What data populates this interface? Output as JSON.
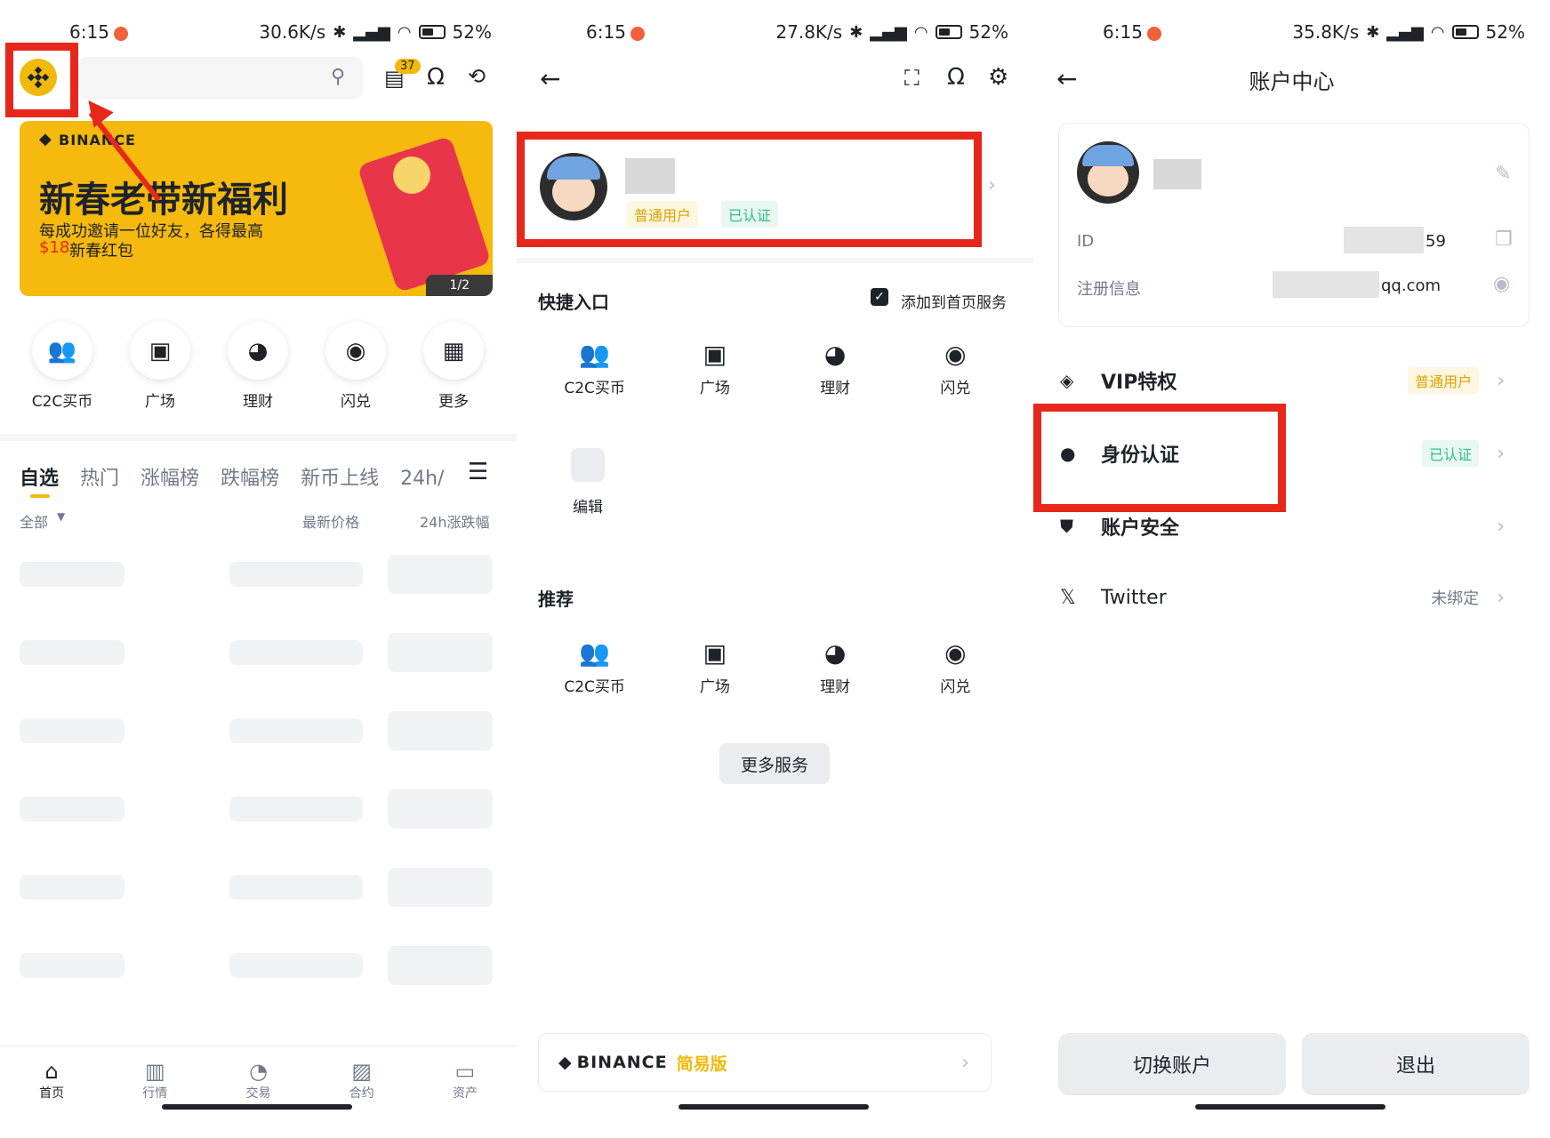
{
  "status": [
    {
      "time": "6:15",
      "speed": "30.6K/s",
      "battery": "52%"
    },
    {
      "time": "6:15",
      "speed": "27.8K/s",
      "battery": "52%"
    },
    {
      "time": "6:15",
      "speed": "35.8K/s",
      "battery": "52%"
    }
  ],
  "p1": {
    "notif_count": "37",
    "banner": {
      "brand": "BINANCE",
      "headline": "新春老带新福利",
      "line1": "每成功邀请一位好友，各得最高",
      "amount": "$18",
      "line2_tail": "新春红包",
      "pager": "1/2"
    },
    "quick": [
      {
        "label": "C2C买币",
        "icon": "people-icon"
      },
      {
        "label": "广场",
        "icon": "square-feed-icon"
      },
      {
        "label": "理财",
        "icon": "piggy-bank-icon"
      },
      {
        "label": "闪兑",
        "icon": "swap-icon"
      },
      {
        "label": "更多",
        "icon": "grid-more-icon"
      }
    ],
    "tabs": [
      "自选",
      "热门",
      "涨幅榜",
      "跌幅榜",
      "新币上线",
      "24h/"
    ],
    "filter": "全部",
    "col_price": "最新价格",
    "col_change": "24h涨跌幅",
    "nav": [
      {
        "label": "首页",
        "icon": "home-icon"
      },
      {
        "label": "行情",
        "icon": "chart-bars-icon"
      },
      {
        "label": "交易",
        "icon": "trade-icon"
      },
      {
        "label": "合约",
        "icon": "futures-icon"
      },
      {
        "label": "资产",
        "icon": "wallet-icon"
      }
    ]
  },
  "p2": {
    "badge_user": "普通用户",
    "badge_verified": "已认证",
    "shortcut_title": "快捷入口",
    "add_home": "添加到首页服务",
    "shortcuts": [
      "C2C买币",
      "广场",
      "理财",
      "闪兑"
    ],
    "edit": "编辑",
    "recommend_title": "推荐",
    "recommend": [
      "C2C买币",
      "广场",
      "理财",
      "闪兑"
    ],
    "more_services": "更多服务",
    "lite_brand": "BINANCE",
    "lite_label": "简易版"
  },
  "p3": {
    "title": "账户中心",
    "id_label": "ID",
    "id_tail": "59",
    "reg_label": "注册信息",
    "reg_tail": "qq.com",
    "rows": [
      {
        "label": "VIP特权",
        "value": "普通用户",
        "icon": "diamond-icon"
      },
      {
        "label": "身份认证",
        "value": "已认证",
        "icon": "person-icon"
      },
      {
        "label": "账户安全",
        "value": "",
        "icon": "shield-icon"
      },
      {
        "label": "Twitter",
        "value": "未绑定",
        "icon": "x-logo-icon"
      }
    ],
    "switch_account": "切换账户",
    "logout": "退出"
  },
  "colors": {
    "brand_yellow": "#f0b90b",
    "highlight_red": "#e8271b",
    "green": "#2ebd85"
  }
}
